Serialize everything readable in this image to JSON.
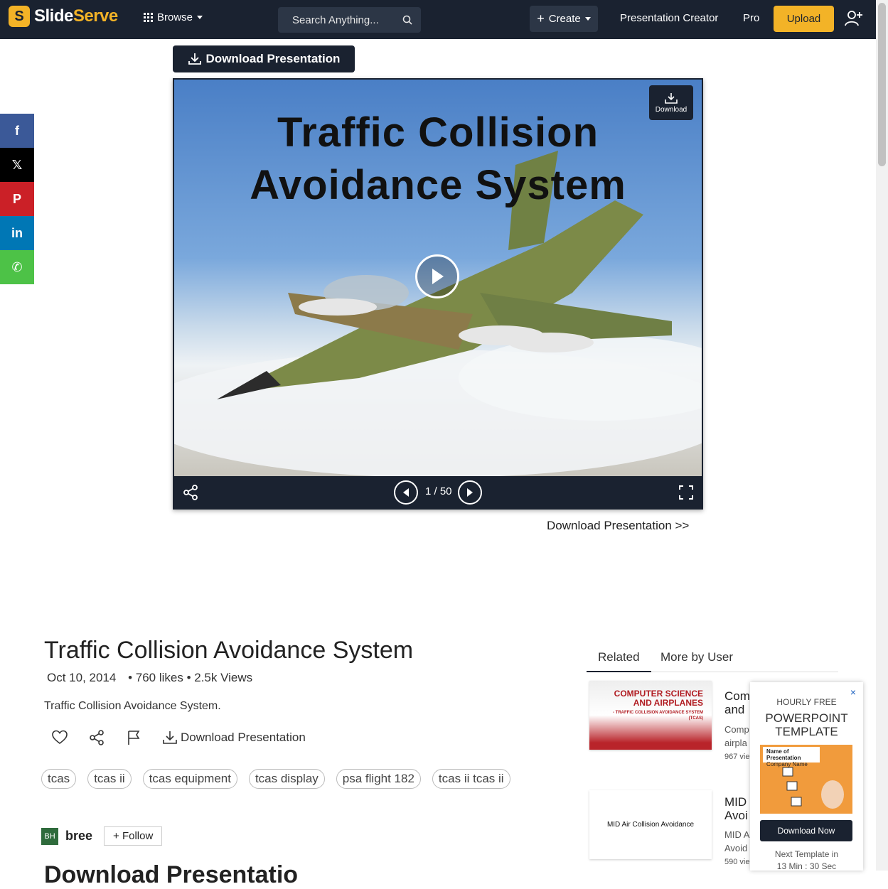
{
  "nav": {
    "logo_letter": "S",
    "logo_text_a": "Slide",
    "logo_text_b": "Serve",
    "browse": "Browse",
    "search_placeholder": "Search Anything...",
    "create": "Create",
    "presentation_creator": "Presentation Creator",
    "pro": "Pro",
    "upload": "Upload"
  },
  "share_rail": [
    {
      "name": "facebook",
      "glyph": "f",
      "color": "#3b5998"
    },
    {
      "name": "x",
      "glyph": "𝕏",
      "color": "#000000"
    },
    {
      "name": "pinterest",
      "glyph": "P",
      "color": "#cb2027"
    },
    {
      "name": "linkedin",
      "glyph": "in",
      "color": "#0077b5"
    },
    {
      "name": "whatsapp",
      "glyph": "✆",
      "color": "#4dc247"
    }
  ],
  "viewer": {
    "download_button": "Download Presentation",
    "slide_title_line1": "Traffic Collision",
    "slide_title_line2": "Avoidance System",
    "slide_download": "Download",
    "page_counter": "1 / 50",
    "download_link": "Download Presentation >>"
  },
  "details": {
    "title": "Traffic Collision Avoidance System",
    "date": "Oct 10, 2014",
    "stats": "• 760 likes • 2.5k Views",
    "description": "Traffic Collision Avoidance System.",
    "download_action": "Download Presentation",
    "tags": [
      "tcas",
      "tcas ii",
      "tcas equipment",
      "tcas display",
      "psa flight 182",
      "tcas ii tcas ii"
    ],
    "author_initials": "BH",
    "author_name": "bree",
    "follow": "+ Follow",
    "cut_heading": "Download Presentatio"
  },
  "sidebar": {
    "tabs": [
      "Related",
      "More by User"
    ],
    "cards": [
      {
        "thumb_text": "COMPUTER SCIENCE AND AIRPLANES",
        "thumb_sub": "- TRAFFIC COLLISION AVOIDANCE SYSTEM (TCAS)",
        "title_l1": "Com",
        "title_l2": "and",
        "sub_l1": "Comp",
        "sub_l2": "airpla",
        "views": "967 vie"
      },
      {
        "thumb_text": "MID Air Collision Avoidance",
        "thumb_sub": "",
        "title_l1": "MID",
        "title_l2": "Avoi",
        "sub_l1": "MID A",
        "sub_l2": "Avoid",
        "views": "590 vie"
      }
    ]
  },
  "ad": {
    "close": "×",
    "label": "HOURLY FREE",
    "title_l1": "POWERPOINT",
    "title_l2": "TEMPLATE",
    "thumb_title": "Name of Presentation",
    "thumb_sub": "Company Name",
    "button": "Download Now",
    "next_l1": "Next Template in",
    "next_l2": "13 Min : 30 Sec"
  }
}
